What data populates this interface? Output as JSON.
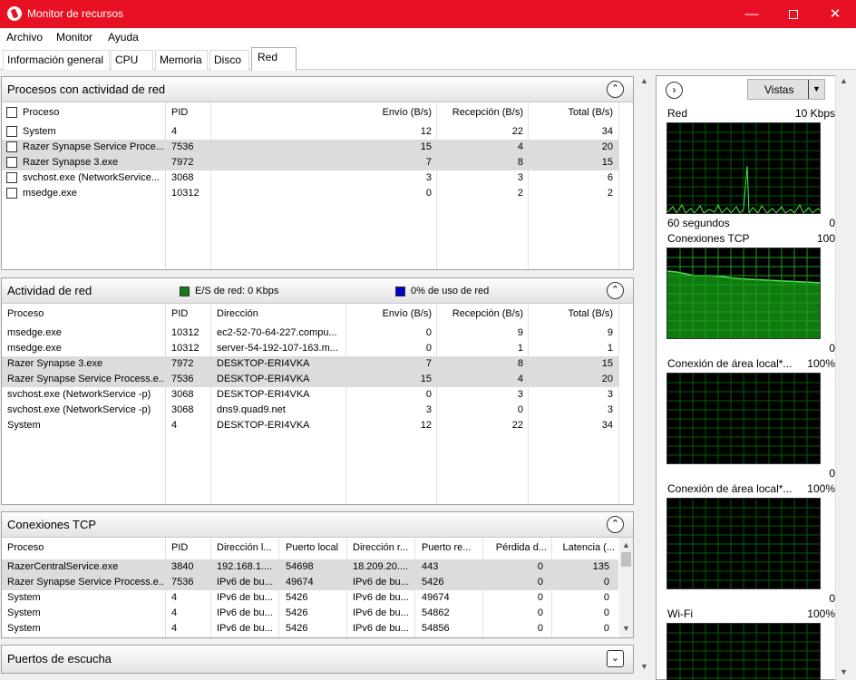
{
  "window": {
    "title": "Monitor de recursos"
  },
  "menu": [
    "Archivo",
    "Monitor",
    "Ayuda"
  ],
  "tabs": [
    "Información general",
    "CPU",
    "Memoria",
    "Disco",
    "Red"
  ],
  "active_tab": "Red",
  "procesos": {
    "title": "Procesos con actividad de red",
    "columns": [
      "Proceso",
      "PID",
      "Envío (B/s)",
      "Recepción (B/s)",
      "Total (B/s)"
    ],
    "rows": [
      {
        "name": "System",
        "pid": "4",
        "send": "12",
        "recv": "22",
        "total": "34"
      },
      {
        "name": "Razer Synapse Service Proce...",
        "pid": "7536",
        "send": "15",
        "recv": "4",
        "total": "20"
      },
      {
        "name": "Razer Synapse 3.exe",
        "pid": "7972",
        "send": "7",
        "recv": "8",
        "total": "15"
      },
      {
        "name": "svchost.exe (NetworkService...",
        "pid": "3068",
        "send": "3",
        "recv": "3",
        "total": "6"
      },
      {
        "name": "msedge.exe",
        "pid": "10312",
        "send": "0",
        "recv": "2",
        "total": "2"
      }
    ]
  },
  "actividad": {
    "title": "Actividad de red",
    "legend_io": "E/S de red: 0 Kbps",
    "legend_usage": "0% de uso de red",
    "io_color": "#1a7a1a",
    "usage_color": "#0000c8",
    "columns": [
      "Proceso",
      "PID",
      "Dirección",
      "Envío (B/s)",
      "Recepción (B/s)",
      "Total (B/s)"
    ],
    "rows": [
      {
        "name": "msedge.exe",
        "pid": "10312",
        "addr": "ec2-52-70-64-227.compu...",
        "send": "0",
        "recv": "9",
        "total": "9"
      },
      {
        "name": "msedge.exe",
        "pid": "10312",
        "addr": "server-54-192-107-163.m...",
        "send": "0",
        "recv": "1",
        "total": "1"
      },
      {
        "name": "Razer Synapse 3.exe",
        "pid": "7972",
        "addr": "DESKTOP-ERI4VKA",
        "send": "7",
        "recv": "8",
        "total": "15"
      },
      {
        "name": "Razer Synapse Service Process.e...",
        "pid": "7536",
        "addr": "DESKTOP-ERI4VKA",
        "send": "15",
        "recv": "4",
        "total": "20"
      },
      {
        "name": "svchost.exe (NetworkService -p)",
        "pid": "3068",
        "addr": "DESKTOP-ERI4VKA",
        "send": "0",
        "recv": "3",
        "total": "3"
      },
      {
        "name": "svchost.exe (NetworkService -p)",
        "pid": "3068",
        "addr": "dns9.quad9.net",
        "send": "3",
        "recv": "0",
        "total": "3"
      },
      {
        "name": "System",
        "pid": "4",
        "addr": "DESKTOP-ERI4VKA",
        "send": "12",
        "recv": "22",
        "total": "34"
      }
    ]
  },
  "tcp": {
    "title": "Conexiones TCP",
    "columns": [
      "Proceso",
      "PID",
      "Dirección l...",
      "Puerto local",
      "Dirección r...",
      "Puerto re...",
      "Pérdida d...",
      "Latencia (..."
    ],
    "rows": [
      {
        "name": "RazerCentralService.exe",
        "pid": "3840",
        "laddr": "192.168.1....",
        "lport": "54698",
        "raddr": "18.209.20....",
        "rport": "443",
        "loss": "0",
        "lat": "135"
      },
      {
        "name": "Razer Synapse Service Process.e...",
        "pid": "7536",
        "laddr": "IPv6 de bu...",
        "lport": "49674",
        "raddr": "IPv6 de bu...",
        "rport": "5426",
        "loss": "0",
        "lat": "0"
      },
      {
        "name": "System",
        "pid": "4",
        "laddr": "IPv6 de bu...",
        "lport": "5426",
        "raddr": "IPv6 de bu...",
        "rport": "49674",
        "loss": "0",
        "lat": "0"
      },
      {
        "name": "System",
        "pid": "4",
        "laddr": "IPv6 de bu...",
        "lport": "5426",
        "raddr": "IPv6 de bu...",
        "rport": "54862",
        "loss": "0",
        "lat": "0"
      },
      {
        "name": "System",
        "pid": "4",
        "laddr": "IPv6 de bu...",
        "lport": "5426",
        "raddr": "IPv6 de bu...",
        "rport": "54856",
        "loss": "0",
        "lat": "0"
      }
    ]
  },
  "puertos": {
    "title": "Puertos de escucha"
  },
  "sidebar": {
    "views_label": "Vistas",
    "graphs": [
      {
        "title": "Red",
        "max": "10 Kbps",
        "foot": "60 segundos",
        "min": "0"
      },
      {
        "title": "Conexiones TCP",
        "max": "100",
        "min": "0"
      },
      {
        "title": "Conexión de área local*...",
        "max": "100%",
        "min": "0"
      },
      {
        "title": "Conexión de área local*...",
        "max": "100%",
        "min": "0"
      },
      {
        "title": "Wi-Fi",
        "max": "100%"
      }
    ]
  }
}
